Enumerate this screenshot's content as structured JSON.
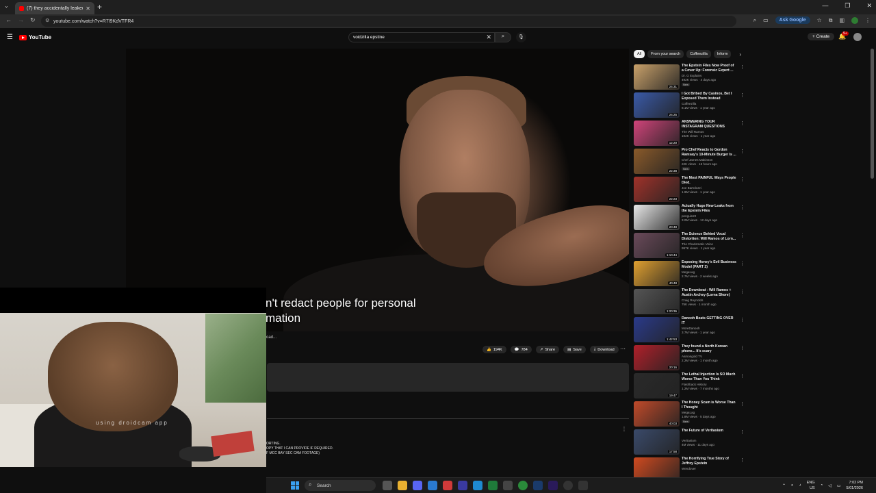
{
  "browser": {
    "tab_title": "(7) they accidentally leaked ec...",
    "tab_close": "✕",
    "new_tab": "+",
    "url": "youtube.com/watch?v=R7I9KdVTFR4",
    "ask_google": "Ask Google",
    "win_min": "—",
    "win_max": "❐",
    "win_close": "✕"
  },
  "youtube": {
    "logo_text": "YouTube",
    "search_value": "voidzilla epstine",
    "create_label": "Create",
    "notif_count": "9+"
  },
  "video": {
    "caption_line1": "n't redact people for personal",
    "caption_line2": "mation",
    "loading_text": "oad...",
    "likes": "194K",
    "comments": "784",
    "share_label": "Share",
    "save_label": "Save",
    "download_label": "Download",
    "desc_line1": "ORTING.",
    "desc_line2": "OPY THAT I CAN PROVIDE IF REQUIRED.",
    "desc_line3": "F MCC BAY SEC CAM FOOTAGE)"
  },
  "webcam": {
    "watermark": "using droidcam app"
  },
  "sidebar": {
    "chips": [
      "All",
      "From your search",
      "Coffeezilla",
      "Inform"
    ],
    "recommendations": [
      {
        "title": "The Epstein Files Now Proof of a Cover Up: Forensic Expert ...",
        "channel": "Dr. G Explains",
        "meta": "492K views · 4 days ago",
        "badge": "New",
        "duration": "24:31",
        "color": "#c9a16a"
      },
      {
        "title": "I Got Bribed By Casinos, Bet I Exposed Them Instead",
        "channel": "Coffeezilla",
        "meta": "8.1M views · 1 year ago",
        "badge": "",
        "duration": "24:25",
        "color": "#3a5aa8"
      },
      {
        "title": "ANSWERING YOUR INSTAGRAM QUESTIONS",
        "channel": "The Will Ramos",
        "meta": "192K views · 1 year ago",
        "badge": "",
        "duration": "12:20",
        "color": "#d0447a"
      },
      {
        "title": "Pro Chef Reacts to Gordon Ramsay's 10-Minute Burger Is ...",
        "channel": "Chef James Makinson",
        "meta": "22K views · 15 hours ago",
        "badge": "New",
        "duration": "22:38",
        "color": "#8a5a2a"
      },
      {
        "title": "The Most PAINFUL Ways People Died.",
        "channel": "Joe Bartolozzi",
        "meta": "1.9M views · 1 year ago",
        "badge": "",
        "duration": "22:23",
        "color": "#a0322a"
      },
      {
        "title": "Actually Huge New Leaks from the Epstein Files",
        "channel": "penguinz0",
        "meta": "3.0M views · 12 days ago",
        "badge": "",
        "duration": "20:48",
        "color": "#e8e8e8"
      },
      {
        "title": "The Science Behind Vocal Distortion: Will Ramos of Lorn...",
        "channel": "The Charismatic Voice",
        "meta": "997K views · 1 year ago",
        "badge": "",
        "duration": "1:10:44",
        "color": "#6a4a5a"
      },
      {
        "title": "Exposing Honey's Evil Business Model (PART 2)",
        "channel": "MegaLag",
        "meta": "2.7M views · 2 weeks ago",
        "badge": "",
        "duration": "40:48",
        "color": "#e0a030"
      },
      {
        "title": "The Downbeat - Will Ramos + Austin Archey (Lorna Shore)",
        "channel": "Craig Reynolds",
        "meta": "75K views · 1 month ago",
        "badge": "",
        "duration": "1:20:36",
        "color": "#555555"
      },
      {
        "title": "Danooh Beats GETTING OVER IT",
        "channel": "MoreDanooh",
        "meta": "3.7M views · 1 year ago",
        "badge": "",
        "duration": "1:42:53",
        "color": "#2a3a8a"
      },
      {
        "title": "They found a North Korean phone... It's scary",
        "channel": "Asmongold TV",
        "meta": "2.2M views · 1 month ago",
        "badge": "",
        "duration": "20:16",
        "color": "#b0202a"
      },
      {
        "title": "The Lethal Injection Is SO Much Worse Than You Think",
        "channel": "Flashback History",
        "meta": "1.2M views · 7 months ago",
        "badge": "",
        "duration": "19:47",
        "color": "#2a2a2a"
      },
      {
        "title": "The Honey Scam is Worse Than I Thought",
        "channel": "MegaLag",
        "meta": "1.8M views · 5 days ago",
        "badge": "New",
        "duration": "40:03",
        "color": "#c04a2a"
      },
      {
        "title": "The Future of Veritasium",
        "channel": "Veritasium",
        "meta": "4M views · 11 days ago",
        "badge": "",
        "duration": "17:58",
        "color": "#3a4a6a"
      },
      {
        "title": "The Horrifying True Story of Jeffrey Epstein",
        "channel": "Wendover",
        "meta": "",
        "badge": "",
        "duration": "",
        "color": "#d04a20"
      }
    ]
  },
  "taskbar": {
    "search_label": "Search",
    "lang1": "ENG",
    "lang2": "US",
    "time": "7:02 PM",
    "date": "5/01/2026"
  }
}
